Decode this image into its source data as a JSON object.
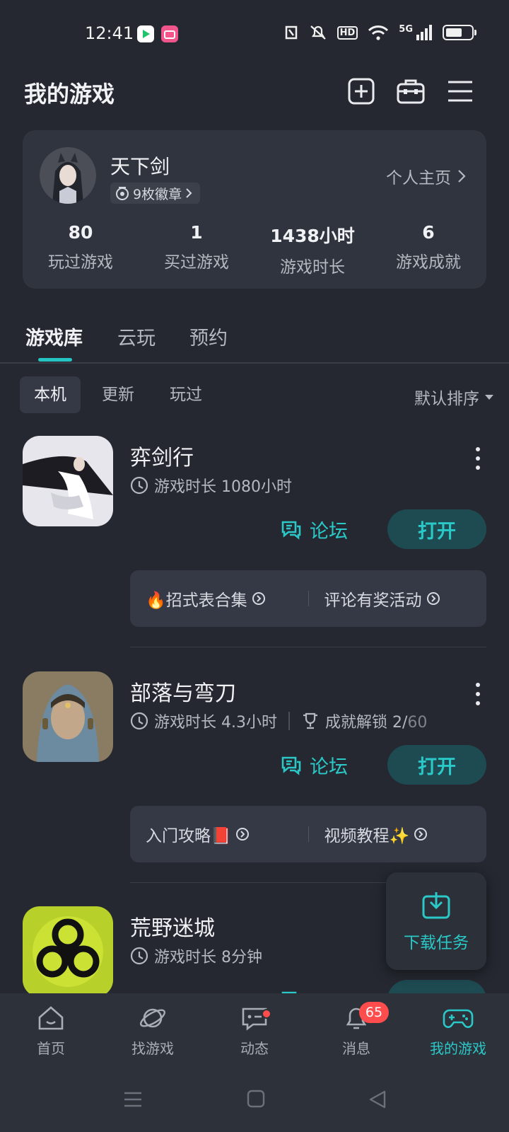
{
  "status_bar": {
    "time": "12:41",
    "hd": "HD",
    "network": "5G"
  },
  "header": {
    "title": "我的游戏",
    "icons": [
      "add-icon",
      "toolbox-icon",
      "menu-icon"
    ]
  },
  "profile": {
    "username": "天下剑",
    "badges": "9枚徽章",
    "home_link": "个人主页",
    "stats": [
      {
        "value": "80",
        "label": "玩过游戏"
      },
      {
        "value": "1",
        "label": "买过游戏"
      },
      {
        "value": "1438小时",
        "label": "游戏时长"
      },
      {
        "value": "6",
        "label": "游戏成就"
      }
    ]
  },
  "tabs": [
    "游戏库",
    "云玩",
    "预约"
  ],
  "subtabs": [
    "本机",
    "更新",
    "玩过"
  ],
  "sort_label": "默认排序",
  "games": [
    {
      "name": "弈剑行",
      "playtime": "游戏时长 1080小时",
      "forum": "论坛",
      "open": "打开",
      "links": [
        "🔥招式表合集",
        "评论有奖活动"
      ]
    },
    {
      "name": "部落与弯刀",
      "playtime": "游戏时长 4.3小时",
      "achievement": "成就解锁 2/",
      "achievement_total": "60",
      "forum": "论坛",
      "open": "打开",
      "links": [
        "入门攻略📕",
        "视频教程✨"
      ]
    },
    {
      "name": "荒野迷城",
      "playtime": "游戏时长 8分钟"
    }
  ],
  "download_fab": "下载任务",
  "bottom_nav": [
    {
      "label": "首页"
    },
    {
      "label": "找游戏"
    },
    {
      "label": "动态"
    },
    {
      "label": "消息",
      "badge": "65"
    },
    {
      "label": "我的游戏"
    }
  ],
  "colors": {
    "background": "#252830",
    "accent": "#2ac9c8",
    "card": "#30343e",
    "badge_red": "#ff4c4c"
  }
}
